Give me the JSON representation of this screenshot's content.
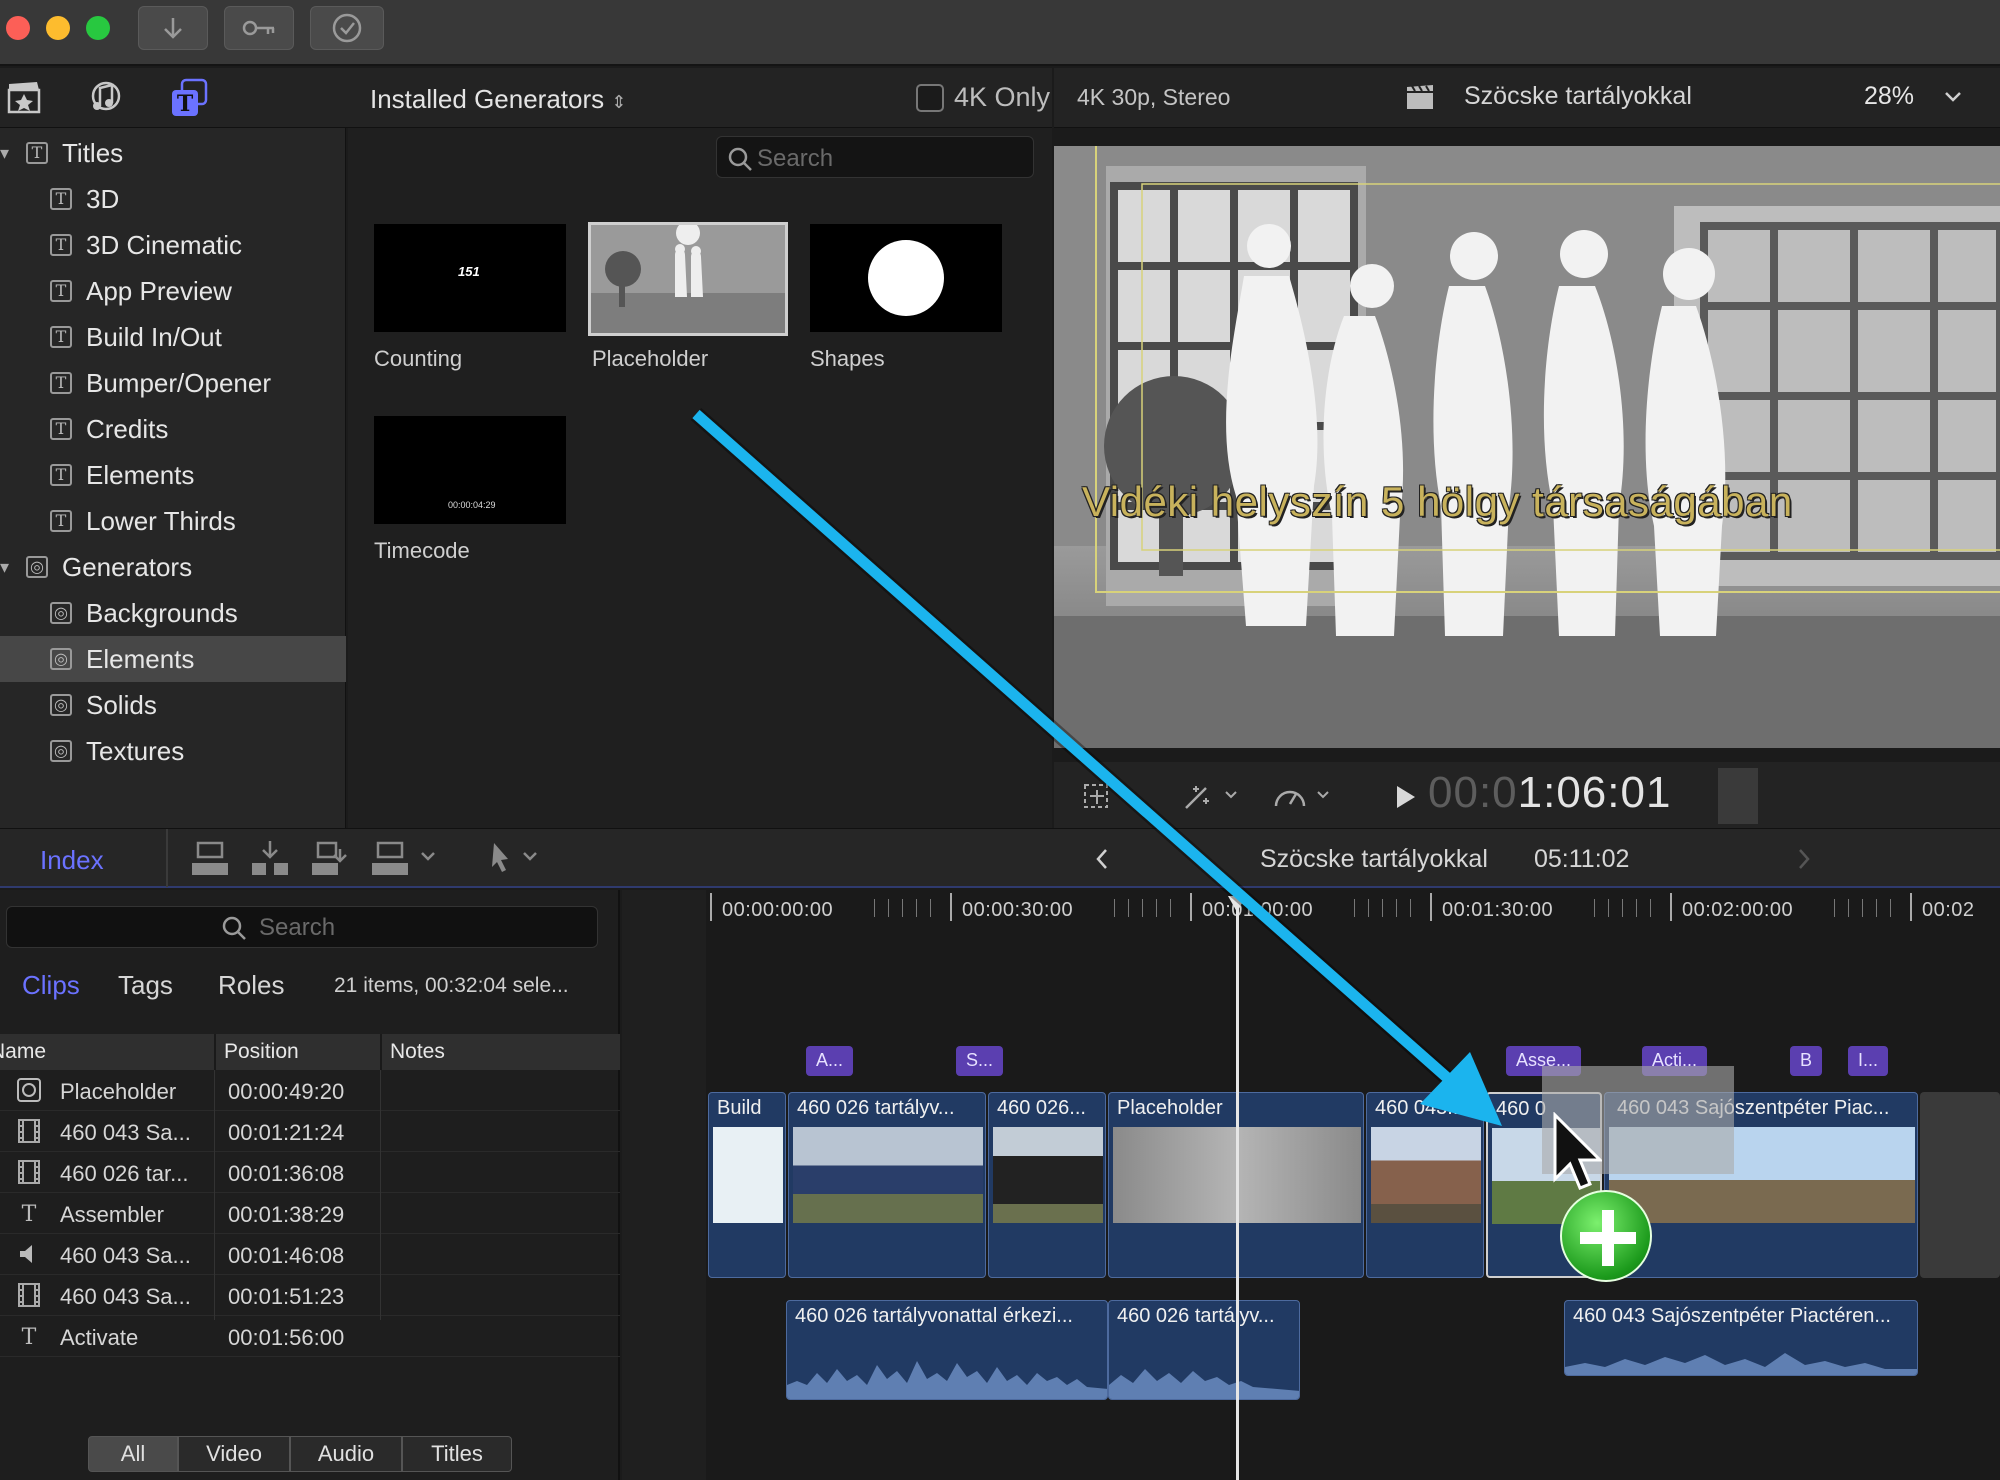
{
  "browser": {
    "source_selector": "Installed Generators",
    "filter_4k": "4K Only",
    "search_placeholder": "Search",
    "categories": [
      {
        "label": "Titles",
        "level": 0
      },
      {
        "label": "3D",
        "level": 1
      },
      {
        "label": "3D Cinematic",
        "level": 1
      },
      {
        "label": "App Preview",
        "level": 1
      },
      {
        "label": "Build In/Out",
        "level": 1
      },
      {
        "label": "Bumper/Opener",
        "level": 1
      },
      {
        "label": "Credits",
        "level": 1
      },
      {
        "label": "Elements",
        "level": 1
      },
      {
        "label": "Lower Thirds",
        "level": 1
      },
      {
        "label": "Generators",
        "level": 0
      },
      {
        "label": "Backgrounds",
        "level": 1
      },
      {
        "label": "Elements",
        "level": 1,
        "selected": true
      },
      {
        "label": "Solids",
        "level": 1
      },
      {
        "label": "Textures",
        "level": 1
      }
    ],
    "generators": [
      {
        "label": "Counting",
        "overlay": "151"
      },
      {
        "label": "Placeholder"
      },
      {
        "label": "Shapes"
      },
      {
        "label": "Timecode",
        "overlay": "00:00:04:29"
      }
    ]
  },
  "viewer": {
    "format": "4K 30p, Stereo",
    "project": "Szöcske tartályokkal",
    "zoom": "28%",
    "caption": "Vidéki helyszín 5 hölgy társaságában",
    "timecode_dim": "00:0",
    "timecode": "1:06:01"
  },
  "timeline_header": {
    "index_label": "Index",
    "project": "Szöcske tartályokkal",
    "duration": "05:11:02"
  },
  "index": {
    "search_placeholder": "Search",
    "tabs": [
      "Clips",
      "Tags",
      "Roles"
    ],
    "summary": "21 items, 00:32:04 sele...",
    "columns": [
      "Name",
      "Position",
      "Notes"
    ],
    "rows": [
      {
        "icon": "generator-icon",
        "name": "Placeholder",
        "position": "00:00:49:20"
      },
      {
        "icon": "film-icon",
        "name": "460 043 Sa...",
        "position": "00:01:21:24"
      },
      {
        "icon": "film-icon",
        "name": "460 026 tar...",
        "position": "00:01:36:08"
      },
      {
        "icon": "title-icon",
        "name": "Assembler",
        "position": "00:01:38:29"
      },
      {
        "icon": "audio-icon",
        "name": "460 043 Sa...",
        "position": "00:01:46:08"
      },
      {
        "icon": "film-icon",
        "name": "460 043 Sa...",
        "position": "00:01:51:23"
      },
      {
        "icon": "title-icon",
        "name": "Activate",
        "position": "00:01:56:00"
      }
    ],
    "filters": [
      "All",
      "Video",
      "Audio",
      "Titles"
    ]
  },
  "timeline": {
    "ruler": [
      "00:00:00:00",
      "00:00:30:00",
      "00:01:00:00",
      "00:01:30:00",
      "00:02:00:00",
      "00:02"
    ],
    "title_markers": [
      "A...",
      "S...",
      "Asse...",
      "Acti...",
      "B",
      "I..."
    ],
    "clips": [
      "Build",
      "460 026 tartályv...",
      "460 026...",
      "Placeholder",
      "460 043...",
      "460 0",
      "460 043 Sajószentpéter Piac..."
    ],
    "audio_clips": [
      "460 026 tartályvonattal érkezi...",
      "460 026 tartályv...",
      "460 043 Sajószentpéter Piactéren..."
    ]
  },
  "colors": {
    "accent": "#6b72ff",
    "clip_blue": "#213a63",
    "marker_purple": "#5b3fb0",
    "arrow": "#1bb4ee"
  }
}
